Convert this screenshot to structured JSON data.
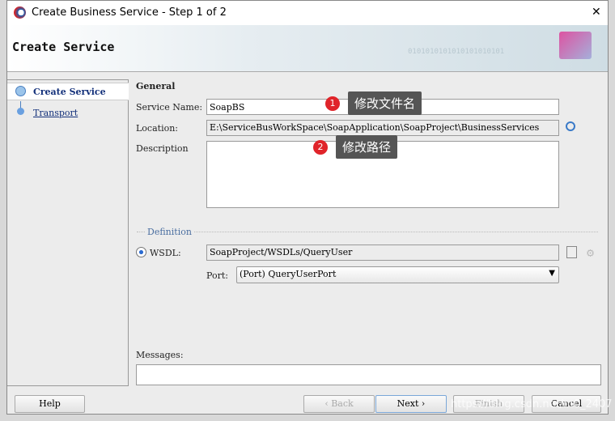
{
  "window": {
    "title": "Create Business Service - Step 1 of 2",
    "close": "✕"
  },
  "header": {
    "title": "Create Service",
    "watermark_bits": "0101010101010101010101"
  },
  "steps": [
    {
      "label": "Create Service",
      "active": true
    },
    {
      "label": "Transport",
      "active": false
    }
  ],
  "general": {
    "title": "General",
    "service_name_label": "Service Name:",
    "service_name": "SoapBS",
    "location_label": "Location:",
    "location": "E:\\ServiceBusWorkSpace\\SoapApplication\\SoapProject\\BusinessServices",
    "description_label": "Description",
    "description": ""
  },
  "definition": {
    "title": "Definition",
    "wsdl_label": "WSDL:",
    "wsdl": "SoapProject/WSDLs/QueryUser",
    "port_label": "Port:",
    "port": "(Port) QueryUserPort"
  },
  "messages_label": "Messages:",
  "annotations": [
    {
      "num": "1",
      "text": "修改文件名"
    },
    {
      "num": "2",
      "text": "修改路径"
    }
  ],
  "buttons": {
    "help": "Help",
    "back": "‹ Back",
    "next": "Next ›",
    "finish": "Finish",
    "cancel": "Cancel"
  },
  "watermark": "https://blog.csdn.net/m0_2407"
}
